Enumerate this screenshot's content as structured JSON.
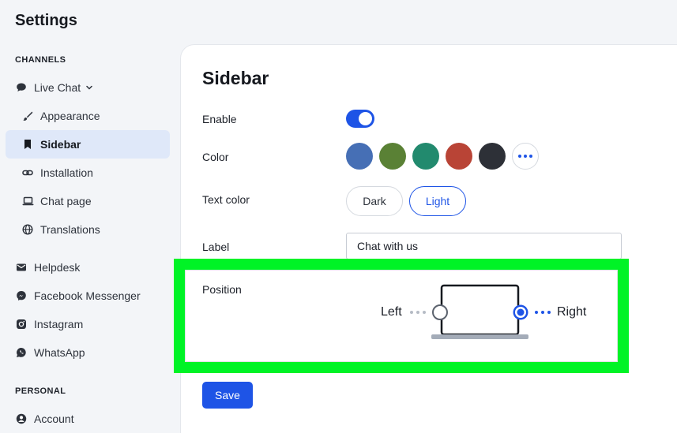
{
  "app": {
    "title": "Settings"
  },
  "sidebar": {
    "channels_heading": "CHANNELS",
    "live_chat": "Live Chat",
    "sub_items": [
      {
        "label": "Appearance",
        "icon": "brush-icon"
      },
      {
        "label": "Sidebar",
        "icon": "bookmark-icon",
        "active": true
      },
      {
        "label": "Installation",
        "icon": "link-icon"
      },
      {
        "label": "Chat page",
        "icon": "laptop-icon"
      },
      {
        "label": "Translations",
        "icon": "globe-icon"
      }
    ],
    "channels": [
      {
        "label": "Helpdesk",
        "icon": "mail-icon"
      },
      {
        "label": "Facebook Messenger",
        "icon": "messenger-icon"
      },
      {
        "label": "Instagram",
        "icon": "instagram-icon"
      },
      {
        "label": "WhatsApp",
        "icon": "whatsapp-icon"
      }
    ],
    "personal_heading": "PERSONAL",
    "account": "Account"
  },
  "page": {
    "title": "Sidebar",
    "enable_label": "Enable",
    "enable_on": true,
    "color_label": "Color",
    "colors": [
      "#466fb5",
      "#5a8135",
      "#228a6e",
      "#b94436",
      "#2d3037"
    ],
    "text_color_label": "Text color",
    "text_color_options": [
      "Dark",
      "Light"
    ],
    "text_color_selected": "Light",
    "label_label": "Label",
    "label_value": "Chat with us",
    "position_label": "Position",
    "position_left": "Left",
    "position_right": "Right",
    "position_selected": "Right",
    "save_label": "Save"
  },
  "theme": {
    "accent": "#1e54e6",
    "highlight": "#00f326",
    "active_nav_bg": "#dfe8f9"
  }
}
